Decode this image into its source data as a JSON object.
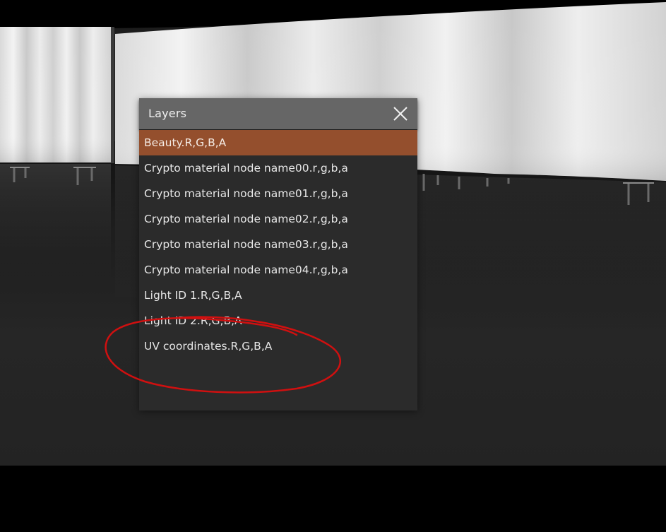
{
  "layers_panel": {
    "title": "Layers",
    "close_icon": "close-icon",
    "selected_index": 0,
    "items": [
      {
        "label": "Beauty.R,G,B,A"
      },
      {
        "label": "Crypto material node name00.r,g,b,a"
      },
      {
        "label": "Crypto material node name01.r,g,b,a"
      },
      {
        "label": "Crypto material node name02.r,g,b,a"
      },
      {
        "label": "Crypto material node name03.r,g,b,a"
      },
      {
        "label": "Crypto material node name04.r,g,b,a"
      },
      {
        "label": "Light ID 1.R,G,B,A"
      },
      {
        "label": "Light ID 2.R,G,B,A"
      },
      {
        "label": "UV coordinates.R,G,B,A"
      }
    ]
  },
  "colors": {
    "panel_background": "#2b2b2b",
    "header_background": "#666666",
    "selected_row": "#944f2d",
    "annotation_stroke": "#d01010"
  }
}
